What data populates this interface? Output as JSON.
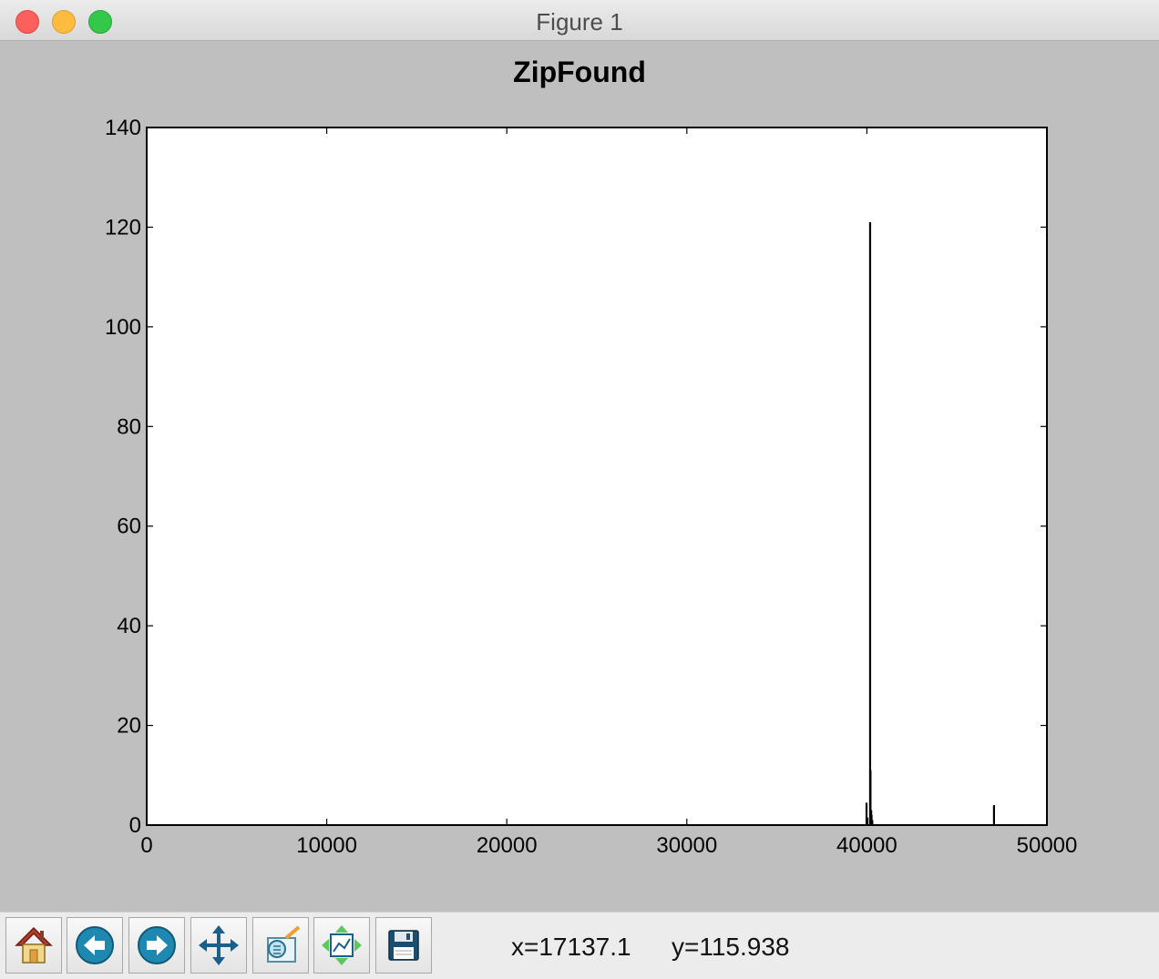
{
  "window": {
    "title": "Figure 1"
  },
  "chart_data": {
    "type": "bar",
    "title": "ZipFound",
    "xlabel": "",
    "ylabel": "",
    "xlim": [
      0,
      50000
    ],
    "ylim": [
      0,
      140
    ],
    "xticks": [
      "0",
      "10000",
      "20000",
      "30000",
      "40000",
      "50000"
    ],
    "yticks": [
      "0",
      "20",
      "40",
      "60",
      "80",
      "100",
      "120",
      "140"
    ],
    "grid": false,
    "x": [
      39980,
      40030,
      40180,
      40200,
      40240,
      40260,
      40300,
      47060
    ],
    "values": [
      4.5,
      1.5,
      121,
      11,
      3,
      2,
      1,
      4
    ],
    "color": "#000000"
  },
  "toolbar": {
    "buttons": [
      {
        "name": "home",
        "icon": "home-icon"
      },
      {
        "name": "back",
        "icon": "back-arrow-icon"
      },
      {
        "name": "forward",
        "icon": "forward-arrow-icon"
      },
      {
        "name": "pan",
        "icon": "pan-move-icon"
      },
      {
        "name": "zoom",
        "icon": "zoom-rect-icon"
      },
      {
        "name": "subplots",
        "icon": "configure-subplots-icon"
      },
      {
        "name": "save",
        "icon": "save-floppy-icon"
      }
    ],
    "x_readout": "x=17137.1",
    "y_readout": "y=115.938"
  }
}
